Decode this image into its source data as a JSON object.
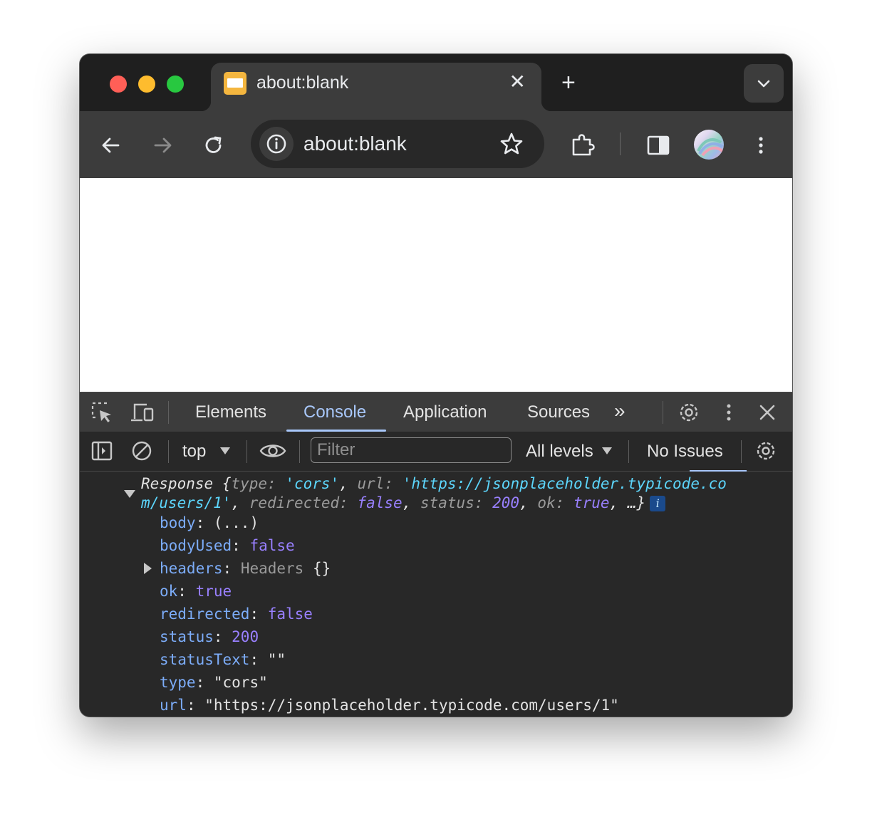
{
  "browser": {
    "tab_title": "about:blank",
    "tab_close": "✕",
    "new_tab": "+",
    "address": "about:blank",
    "icons": [
      "back-arrow-icon",
      "forward-arrow-icon",
      "reload-icon",
      "info-icon",
      "star-icon",
      "extensions-puzzle-icon",
      "side-panel-icon",
      "profile-avatar",
      "more-vert-icon",
      "tab-search-chevron-icon"
    ]
  },
  "devtools": {
    "tabs": [
      "Elements",
      "Console",
      "Application",
      "Sources"
    ],
    "active_tab": "Console",
    "more_tabs": "»",
    "context": "top",
    "filter_placeholder": "Filter",
    "levels": "All levels",
    "issues": "No Issues"
  },
  "console": {
    "summary": {
      "class": "Response",
      "open": "{",
      "k_type": "type",
      "v_type": "'cors'",
      "k_url": "url",
      "v_url1": "'https://jsonplaceholder.typicode.co",
      "v_url2": "m/users/1'",
      "k_redirected": "redirected",
      "v_redirected": "false",
      "k_status": "status",
      "v_status": "200",
      "k_ok": "ok",
      "v_ok": "true",
      "close": "…}",
      "info": "i"
    },
    "props": [
      {
        "key": "body",
        "value": "(...)"
      },
      {
        "key": "bodyUsed",
        "value": "false"
      },
      {
        "key": "headers",
        "value": "Headers",
        "extra": "{}"
      },
      {
        "key": "ok",
        "value": "true"
      },
      {
        "key": "redirected",
        "value": "false"
      },
      {
        "key": "status",
        "value": "200"
      },
      {
        "key": "statusText",
        "value": "\"\""
      },
      {
        "key": "type",
        "value": "\"cors\""
      },
      {
        "key": "url",
        "value": "\"https://jsonplaceholder.typicode.com/users/1\""
      }
    ]
  },
  "colors": {
    "chrome_bg": "#1f1f1f",
    "toolbar_bg": "#3c3c3c",
    "devtools_bg": "#282828",
    "accent": "#a8c7fa",
    "string": "#5cd5fb",
    "number_keyword": "#9980ff",
    "key": "#7cacf8"
  }
}
